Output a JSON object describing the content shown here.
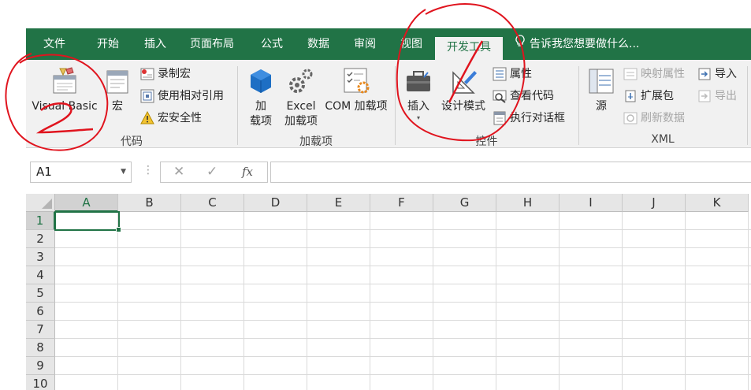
{
  "tabs": [
    {
      "label": "文件",
      "active": false
    },
    {
      "label": "开始",
      "active": false
    },
    {
      "label": "插入",
      "active": false
    },
    {
      "label": "页面布局",
      "active": false
    },
    {
      "label": "公式",
      "active": false
    },
    {
      "label": "数据",
      "active": false
    },
    {
      "label": "审阅",
      "active": false
    },
    {
      "label": "视图",
      "active": false
    },
    {
      "label": "开发工具",
      "active": true
    }
  ],
  "tellme": "告诉我您想要做什么...",
  "ribbon": {
    "code": {
      "label": "代码",
      "visual_basic": "Visual Basic",
      "macros": "宏",
      "record_macro": "录制宏",
      "relative_ref": "使用相对引用",
      "macro_security": "宏安全性"
    },
    "addins": {
      "label": "加载项",
      "addins_line1": "加",
      "addins_line2": "载项",
      "excel_addins_line1": "Excel",
      "excel_addins_line2": "加载项",
      "com_addins": "COM 加载项"
    },
    "controls": {
      "label": "控件",
      "insert": "插入",
      "design_mode": "设计模式",
      "properties": "属性",
      "view_code": "查看代码",
      "run_dialog": "执行对话框"
    },
    "xml": {
      "label": "XML",
      "source": "源",
      "map_properties": "映射属性",
      "expansion_packs": "扩展包",
      "refresh_data": "刷新数据",
      "import": "导入",
      "export": "导出"
    }
  },
  "formula_bar": {
    "name_box": "A1",
    "cancel": "✕",
    "enter": "✓",
    "fx": "fx",
    "content": ""
  },
  "sheet": {
    "columns": [
      "A",
      "B",
      "C",
      "D",
      "E",
      "F",
      "G",
      "H",
      "I",
      "J",
      "K"
    ],
    "rows": [
      "1",
      "2",
      "3",
      "4",
      "5",
      "6",
      "7",
      "8",
      "9",
      "10"
    ],
    "active_cell": "A1"
  },
  "annotations": {
    "color": "#e0141e",
    "marks": [
      "2",
      "1"
    ]
  },
  "colors": {
    "accent": "#217346",
    "ribbon_bg": "#f1f1f1"
  }
}
